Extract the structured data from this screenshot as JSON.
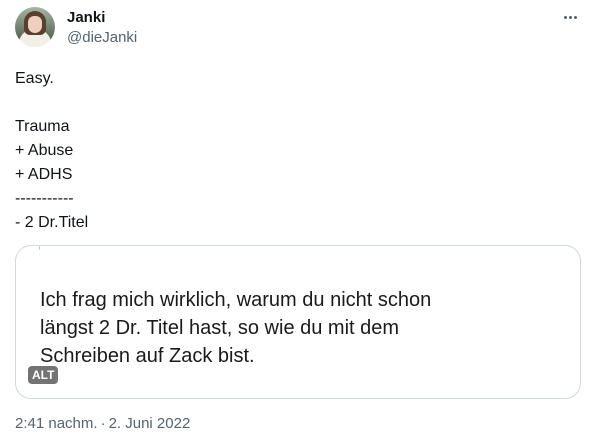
{
  "author": {
    "name": "Janki",
    "handle": "@dieJanki",
    "avatar_icon": "profile-photo"
  },
  "more_menu_icon": "ellipsis-icon",
  "tweet": {
    "text": "Easy.\n\nTrauma\n+ Abuse\n+ ADHS\n-----------\n- 2 Dr.Titel"
  },
  "media": {
    "text": "Ich frag mich wirklich, warum du nicht schon\nlängst 2 Dr. Titel hast, so wie du  mit dem\nSchreiben auf Zack bist.",
    "alt_label": "ALT"
  },
  "meta": {
    "time": "2:41 nachm.",
    "separator": "·",
    "date": "2. Juni 2022"
  },
  "colors": {
    "text": "#0f1419",
    "secondary": "#536471",
    "border": "#cfd9de"
  }
}
